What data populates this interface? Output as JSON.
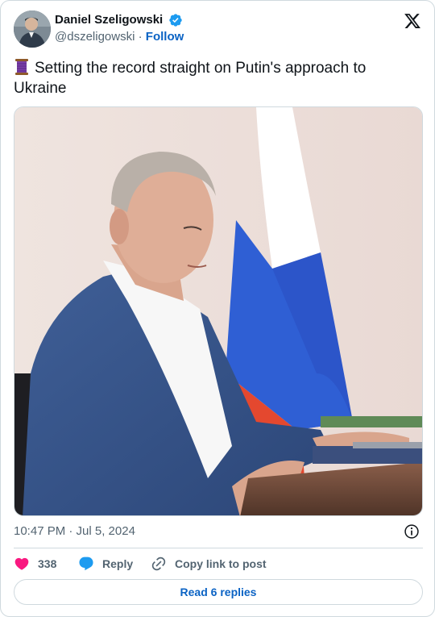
{
  "author": {
    "display_name": "Daniel Szeligowski",
    "handle": "@dszeligowski",
    "separator": "·",
    "follow_label": "Follow"
  },
  "tweet": {
    "text": "Setting the record straight on Putin's approach to Ukraine",
    "leading_emoji": "thread-spool-icon"
  },
  "media": {
    "kind": "photo"
  },
  "timestamp": "10:47 PM · Jul 5, 2024",
  "actions": {
    "like_count": "338",
    "reply_label": "Reply",
    "copy_label": "Copy link to post"
  },
  "read_replies_label": "Read 6 replies",
  "colors": {
    "like": "#f91880",
    "reply": "#1d9bf0",
    "link": "#0b63c4",
    "verified": "#1d9bf0",
    "muted": "#536471"
  }
}
